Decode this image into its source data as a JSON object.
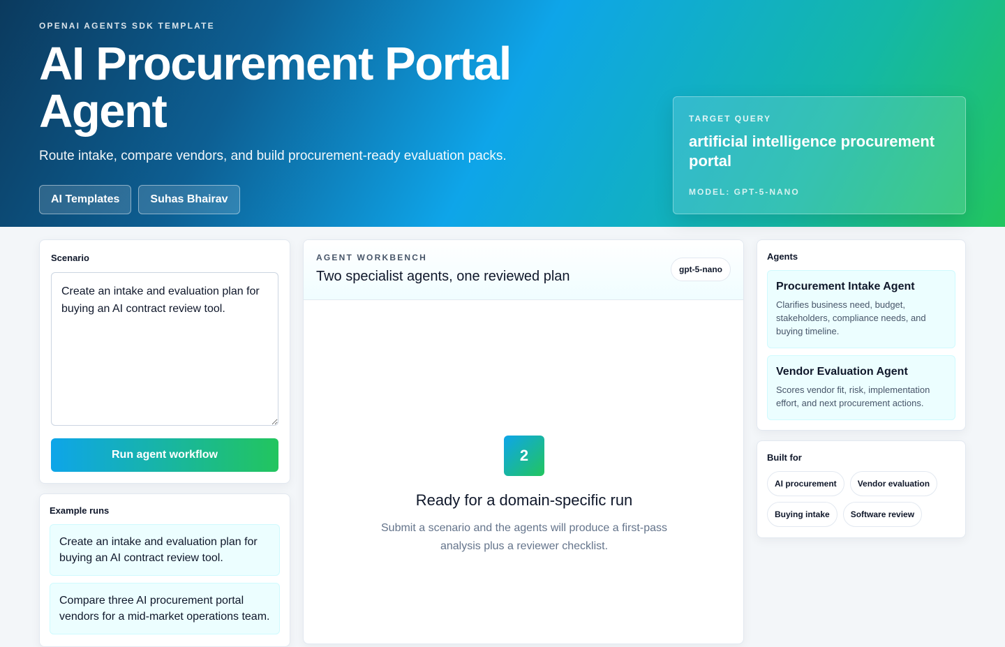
{
  "hero": {
    "eyebrow": "OPENAI AGENTS SDK TEMPLATE",
    "title": "AI Procurement Portal Agent",
    "subtitle": "Route intake, compare vendors, and build procurement-ready evaluation packs.",
    "chips": [
      "AI Templates",
      "Suhas Bhairav"
    ]
  },
  "target": {
    "label": "TARGET QUERY",
    "query": "artificial intelligence procurement portal",
    "model": "MODEL: GPT-5-NANO"
  },
  "scenario": {
    "heading": "Scenario",
    "value": "Create an intake and evaluation plan for buying an AI contract review tool.",
    "run_label": "Run agent workflow"
  },
  "examples": {
    "heading": "Example runs",
    "items": [
      "Create an intake and evaluation plan for buying an AI contract review tool.",
      "Compare three AI procurement portal vendors for a mid-market operations team."
    ]
  },
  "workbench": {
    "eyebrow": "AGENT WORKBENCH",
    "title": "Two specialist agents, one reviewed plan",
    "model_pill": "gpt-5-nano",
    "badge": "2",
    "empty_title": "Ready for a domain-specific run",
    "empty_sub": "Submit a scenario and the agents will produce a first-pass analysis plus a reviewer checklist."
  },
  "agents": {
    "heading": "Agents",
    "items": [
      {
        "name": "Procurement Intake Agent",
        "desc": "Clarifies business need, budget, stakeholders, compliance needs, and buying timeline."
      },
      {
        "name": "Vendor Evaluation Agent",
        "desc": "Scores vendor fit, risk, implementation effort, and next procurement actions."
      }
    ]
  },
  "built_for": {
    "heading": "Built for",
    "tags": [
      "AI procurement",
      "Vendor evaluation",
      "Buying intake",
      "Software review"
    ]
  },
  "colors": {
    "accent_start": "#0ea5e9",
    "accent_end": "#22c55e",
    "card_tint": "#ecfeff"
  }
}
